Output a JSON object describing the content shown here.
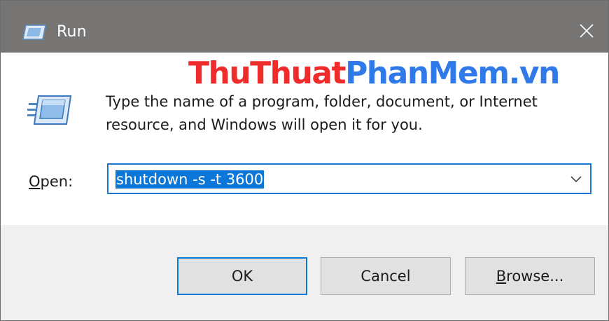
{
  "window": {
    "title": "Run",
    "title_icon": "run-icon",
    "close_symbol": "×"
  },
  "watermark": {
    "part1": "ThuThuat",
    "part2": "PhanMem",
    "part3": ".vn",
    "colors": {
      "part1": "#ef2c2c",
      "part2": "#3079e8",
      "part3": "#3079e8"
    }
  },
  "dialog": {
    "description_line1": "Type the name of a program, folder, document, or Internet",
    "description_line2": "resource, and Windows will open it for you.",
    "open_label_mnemonic": "O",
    "open_label_rest": "pen:",
    "open_value": "shutdown -s -t 3600"
  },
  "buttons": {
    "ok": "OK",
    "cancel": "Cancel",
    "browse_mnemonic": "B",
    "browse_rest": "rowse..."
  },
  "colors": {
    "titlebar": "#777573",
    "accent": "#0d77d9",
    "footer": "#f0f0f0"
  }
}
